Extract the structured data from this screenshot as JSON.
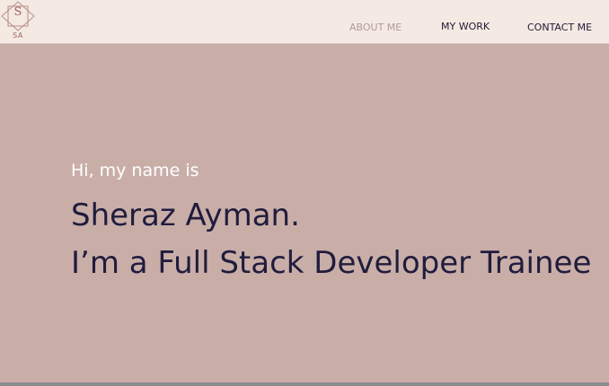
{
  "header": {
    "logo": {
      "letter": "S",
      "subtitle": "SA"
    },
    "nav": [
      {
        "label": "ABOUT ME",
        "active": true
      },
      {
        "label": "MY WORK",
        "active": false
      },
      {
        "label": "CONTACT ME",
        "active": false
      }
    ]
  },
  "hero": {
    "greeting": "Hi, my name is",
    "name": "Sheraz Ayman.",
    "role": "I’m a Full Stack Developer Trainee"
  },
  "colors": {
    "nav_background": "#f5e9e4",
    "page_background": "#c9aea8",
    "heading_text": "#201c3d",
    "active_nav": "#b49a96",
    "logo_accent": "#a0645f"
  }
}
